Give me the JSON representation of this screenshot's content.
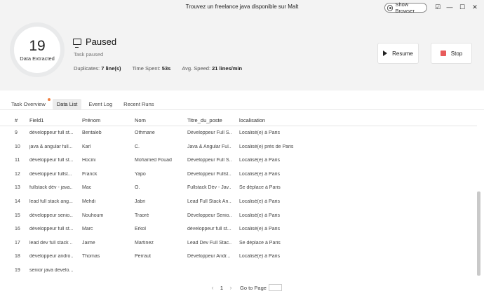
{
  "window": {
    "title": "Trouvez un freelance java disponible sur Malt",
    "show_browser_label": "Show Browser",
    "controls": [
      "☑",
      "—",
      "☐",
      "✕"
    ]
  },
  "status": {
    "count": "19",
    "count_label": "Data Extracted",
    "title": "Paused",
    "subtitle": "Task paused",
    "duplicates_label": "Duplicates:",
    "duplicates_value": "7 line(s)",
    "time_label": "Time Spent:",
    "time_value": "53s",
    "speed_label": "Avg. Speed:",
    "speed_value": "21 lines/min"
  },
  "actions": {
    "resume_label": "Resume",
    "stop_label": "Stop",
    "stop_color": "#e85b5b"
  },
  "tabs": [
    {
      "label": "Task Overview",
      "has_dot": true
    },
    {
      "label": "Data List",
      "active": true
    },
    {
      "label": "Event Log"
    },
    {
      "label": "Recent Runs"
    }
  ],
  "table": {
    "headers": [
      "#",
      "Field1",
      "Prénom",
      "Nom",
      "Titre_du_poste",
      "localisation"
    ],
    "rows": [
      [
        "9",
        "développeur full st...",
        "Bentaleb",
        "Othmane",
        "Développeur Full S...",
        "Localisé(e) à Paris"
      ],
      [
        "10",
        "java & angular full...",
        "Karl",
        "C.",
        "Java & Angular Ful...",
        "Localisé(e) près de Paris"
      ],
      [
        "11",
        "développeur full st...",
        "Hocini",
        "Mohamed Fouad",
        "Développeur Full S...",
        "Localisé(e) à Paris"
      ],
      [
        "12",
        "développeur fullst...",
        "Franck",
        "Yapo",
        "Développeur Fullst...",
        "Localisé(e) à Paris"
      ],
      [
        "13",
        "fullstack dév - java...",
        "Mac",
        "O.",
        "Fullstack Dév - Jav...",
        "Se déplace à Paris"
      ],
      [
        "14",
        "lead full stack ang...",
        "Mehdi",
        "Jabri",
        "Lead Full Stack An...",
        "Localisé(e) à Paris"
      ],
      [
        "15",
        "développeur senio...",
        "Nouhoum",
        "Traoré",
        "Développeur Senio...",
        "Localisé(e) à Paris"
      ],
      [
        "16",
        "développeur full st...",
        "Marc",
        "Erkol",
        "développeur full st...",
        "Localisé(e) à Paris"
      ],
      [
        "17",
        "lead dev full stack ...",
        "Jaime",
        "Martinez",
        "Lead Dev Full Stac...",
        "Se déplace à Paris"
      ],
      [
        "18",
        "développeur andro...",
        "Thomas",
        "Perraut",
        "Développeur Andr...",
        "Localisé(e) à Paris"
      ],
      [
        "19",
        "senior java develo...",
        "",
        "",
        "",
        ""
      ]
    ]
  },
  "pagination": {
    "prev": "‹",
    "page": "1",
    "next": "›",
    "goto_label": "Go to Page"
  }
}
